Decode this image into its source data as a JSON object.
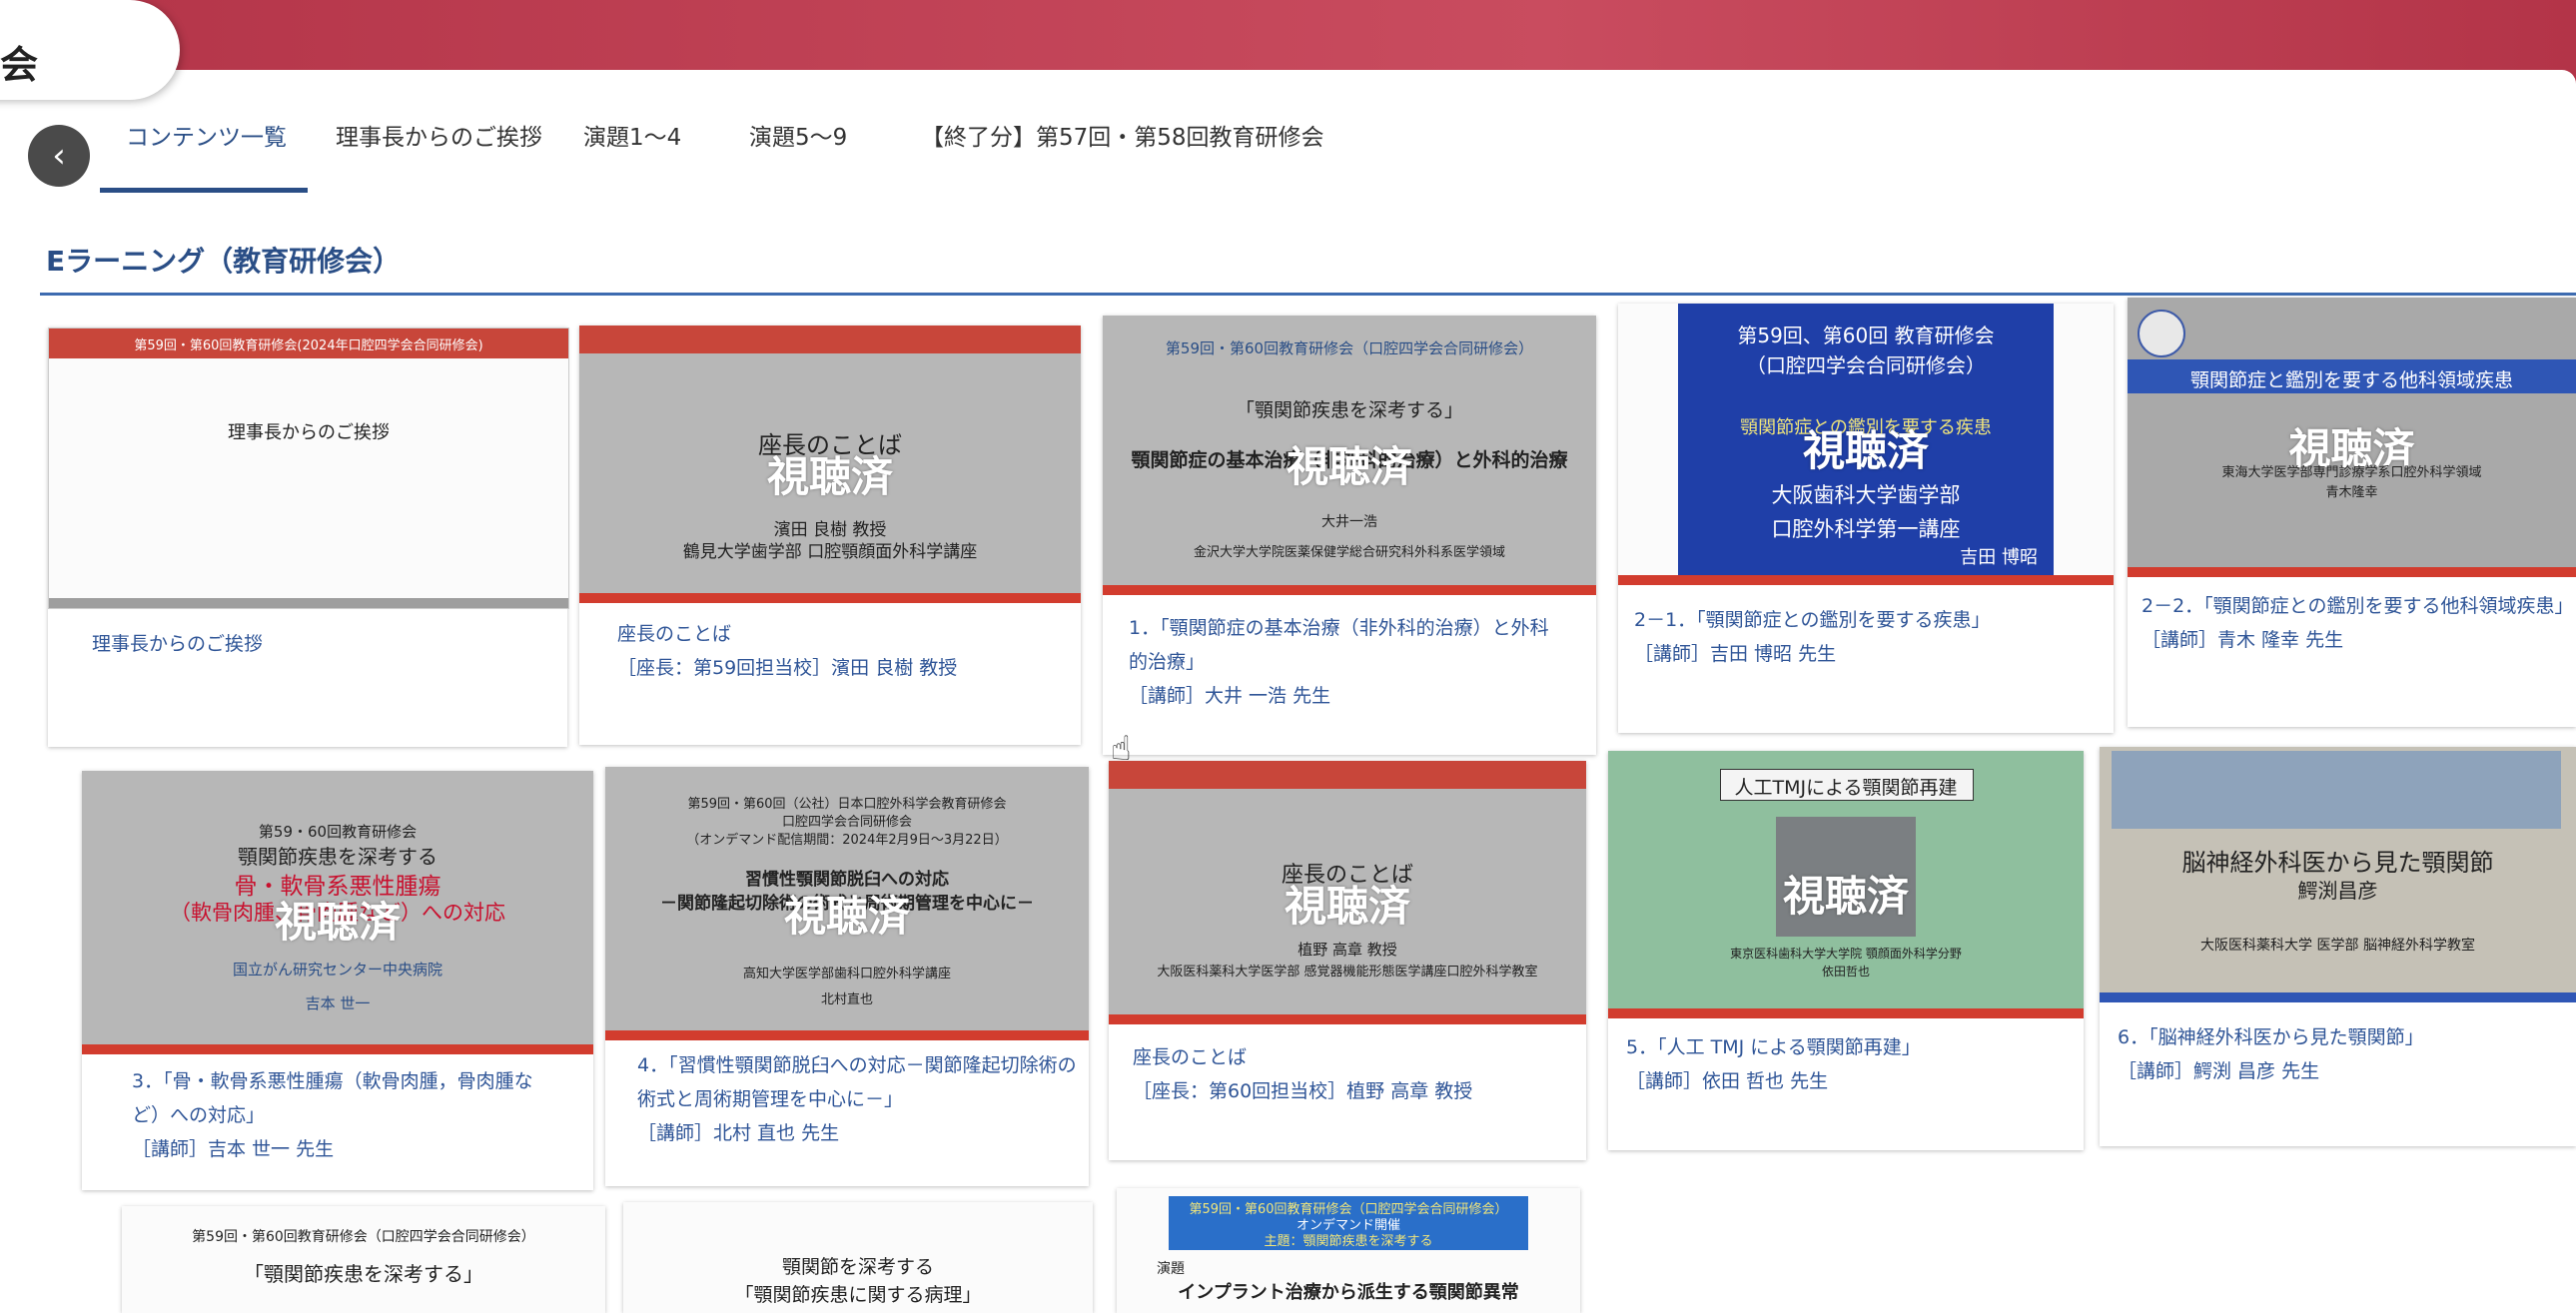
{
  "header": {
    "logo_text": "学会"
  },
  "nav": {
    "back_label": "‹",
    "tabs": [
      {
        "label": "コンテンツ一覧"
      },
      {
        "label": "理事長からのご挨拶"
      },
      {
        "label": "演題1～4"
      },
      {
        "label": "演題5～9"
      },
      {
        "label": "【終了分】第57回・第58回教育研修会"
      }
    ]
  },
  "section": {
    "title": "Eラーニング（教育研修会）"
  },
  "viewed_label": "視聴済",
  "cards": [
    {
      "slide": [
        "第59回・第60回教育研修会(2024年口腔四学会合同研修会)",
        "理事長からのご挨拶"
      ],
      "caption": [
        "理事長からのご挨拶"
      ]
    },
    {
      "slide": [
        "座長のことば",
        "濱田 良樹 教授",
        "鶴見大学歯学部 口腔顎顔面外科学講座"
      ],
      "caption": [
        "座長のことば",
        "［座長：第59回担当校］濱田 良樹 教授"
      ]
    },
    {
      "slide": [
        "第59回・第60回教育研修会（口腔四学会合同研修会）",
        "「顎関節疾患を深考する」",
        "顎関節症の基本治療（非外科的治療）と外科的治療",
        "大井一浩",
        "金沢大学大学院医薬保健学総合研究科外科系医学領域"
      ],
      "caption": [
        "1．「顎関節症の基本治療（非外科的治療）と外科",
        "的治療」",
        "［講師］大井 一浩 先生"
      ]
    },
    {
      "slide": [
        "第59回、第60回 教育研修会",
        "（口腔四学会合同研修会）",
        "顎関節症との鑑別を要する疾患",
        "大阪歯科大学歯学部",
        "口腔外科学第一講座",
        "吉田 博昭"
      ],
      "caption": [
        "2－1．「顎関節症との鑑別を要する疾患」",
        "［講師］吉田 博昭 先生"
      ]
    },
    {
      "slide": [
        "顎関節症と鑑別を要する他科領域疾患",
        "東海大学医学部専門診療学系口腔外科学領域",
        "青木隆幸"
      ],
      "caption": [
        "2－2．「顎関節症との鑑別を要する他科領域疾患」",
        "［講師］青木 隆幸 先生"
      ]
    },
    {
      "slide": [
        "第59・60回教育研修会",
        "顎関節疾患を深考する",
        "骨・軟骨系悪性腫瘍",
        "（軟骨肉腫、骨肉腫など）への対応",
        "国立がん研究センター中央病院",
        "吉本 世一"
      ],
      "caption": [
        "3．「骨・軟骨系悪性腫瘍（軟骨肉腫，骨肉腫な",
        "ど）への対応」",
        "［講師］吉本 世一 先生"
      ]
    },
    {
      "slide": [
        "第59回・第60回（公社）日本口腔外科学会教育研修会",
        "口腔四学会合同研修会",
        "（オンデマンド配信期間：2024年2月9日～3月22日）",
        "習慣性顎関節脱臼への対応",
        "－関節隆起切除術の術式と周術期管理を中心に－",
        "高知大学医学部歯科口腔外科学講座",
        "北村直也"
      ],
      "caption": [
        "4．「習慣性顎関節脱臼への対応－関節隆起切除術の",
        "術式と周術期管理を中心に－」",
        "［講師］北村 直也 先生"
      ]
    },
    {
      "slide": [
        "座長のことば",
        "植野 高章 教授",
        "大阪医科薬科大学医学部 感覚器機能形態医学講座口腔外科学教室"
      ],
      "caption": [
        "座長のことば",
        "［座長：第60回担当校］植野 高章 教授"
      ]
    },
    {
      "slide": [
        "人工TMJによる顎関節再建",
        "東京医科歯科大学大学院 顎顔面外科学分野",
        "依田哲也"
      ],
      "caption": [
        "5．「人工 TMJ による顎関節再建」",
        "［講師］依田 哲也 先生"
      ]
    },
    {
      "slide": [
        "脳神経外科医から見た顎関節",
        "鰐渕昌彦",
        "大阪医科薬科大学 医学部 脳神経外科学教室"
      ],
      "caption": [
        "6．「脳神経外科医から見た顎関節」",
        "［講師］鰐渕 昌彦 先生"
      ]
    },
    {
      "slide": [
        "第59回・第60回教育研修会（口腔四学会合同研修会）",
        "「顎関節疾患を深考する」"
      ],
      "caption": []
    },
    {
      "slide": [
        "顎関節を深考する",
        "「顎関節疾患に関する病理」"
      ],
      "caption": []
    },
    {
      "slide": [
        "第59回・第60回教育研修会（口腔四学会合同研修会）",
        "オンデマンド開催",
        "主題：顎関節疾患を深考する",
        "演題",
        "インプラント治療から派生する顎関節異常"
      ],
      "caption": []
    }
  ]
}
